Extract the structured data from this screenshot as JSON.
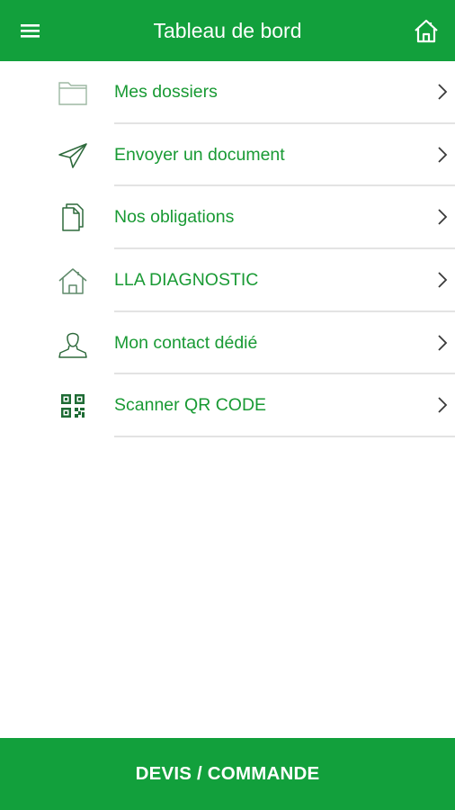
{
  "header": {
    "title": "Tableau de bord",
    "menu_icon": "hamburger-menu-icon",
    "home_icon": "home-icon"
  },
  "menu": {
    "items": [
      {
        "label": "Mes dossiers",
        "icon": "folder-icon"
      },
      {
        "label": "Envoyer un document",
        "icon": "send-icon"
      },
      {
        "label": "Nos obligations",
        "icon": "document-icon"
      },
      {
        "label": "LLA DIAGNOSTIC",
        "icon": "home-icon"
      },
      {
        "label": "Mon contact dédié",
        "icon": "user-icon"
      },
      {
        "label": "Scanner QR CODE",
        "icon": "qr-code-icon"
      }
    ]
  },
  "footer": {
    "label": "DEVIS / COMMANDE"
  },
  "colors": {
    "primary": "#12a03c",
    "text_green": "#199a34",
    "divider": "#e3e3e3",
    "background": "#ffffff"
  }
}
